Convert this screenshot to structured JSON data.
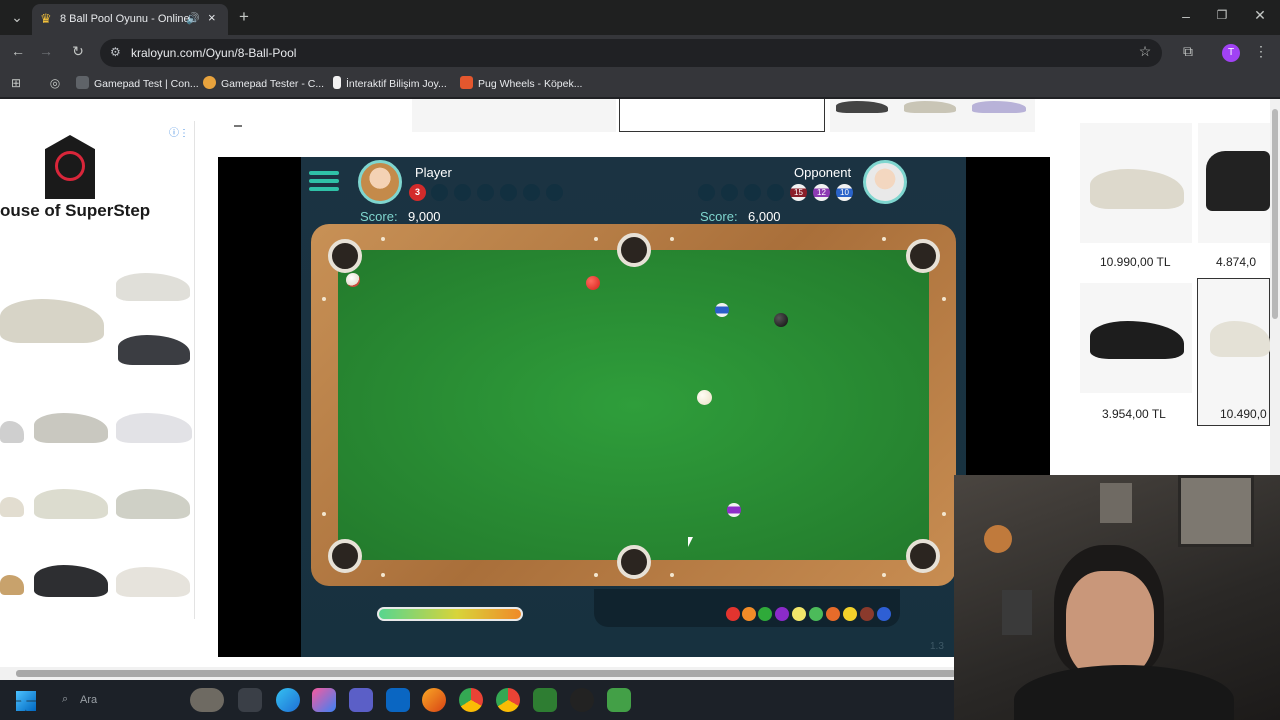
{
  "browser": {
    "tab_title": "8 Ball Pool Oyunu - Online",
    "url": "kraloyun.com/Oyun/8-Ball-Pool",
    "bookmarks": [
      {
        "label": "Gamepad Test | Con...",
        "color": "#5f6368"
      },
      {
        "label": "Gamepad Tester - C...",
        "color": "#e8a33d"
      },
      {
        "label": "İnteraktif Bilişim Joy...",
        "color": "#f2f2f2"
      },
      {
        "label": "Pug Wheels - Köpek...",
        "color": "#e4572e"
      }
    ],
    "profile_initial": "T"
  },
  "ad_left": {
    "brand": "ouse of SuperStep"
  },
  "ad_right": {
    "prices": [
      "10.990,00 TL",
      "4.874,0",
      "3.954,00 TL",
      "10.490,0"
    ]
  },
  "game": {
    "player": {
      "name": "Player",
      "score_label": "Score:",
      "score": "9,000",
      "ball": "3"
    },
    "opponent": {
      "name": "Opponent",
      "score_label": "Score:",
      "score": "6,000",
      "balls": [
        "15",
        "12",
        "10"
      ]
    },
    "version": "1.3"
  },
  "taskbar": {
    "search_label": "Ara"
  },
  "colors": {
    "felt": "#2b8f35",
    "rail": "#b87b41",
    "hud": "#1b3342",
    "accent": "#7fd6cf"
  }
}
